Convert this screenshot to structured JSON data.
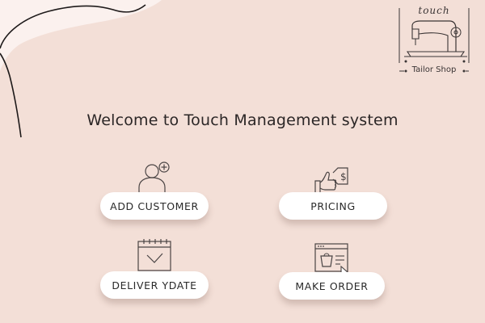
{
  "header": {
    "welcome_text": "Welcome to Touch Management system"
  },
  "logo": {
    "top_text": "touch",
    "bottom_text": "Tailor Shop",
    "icon": "sewing-machine-icon"
  },
  "actions": {
    "add_customer": {
      "label": "ADD CUSTOMER",
      "icon": "add-user-icon"
    },
    "pricing": {
      "label": "PRICING",
      "icon": "price-tag-hand-icon"
    },
    "deliver_date": {
      "label": "DELIVER YDATE",
      "icon": "calendar-check-icon"
    },
    "make_order": {
      "label": "MAKE ORDER",
      "icon": "shopping-bag-window-icon"
    }
  },
  "colors": {
    "background": "#f3dfd7",
    "button": "#ffffff",
    "text": "#2a2a2a",
    "icon_stroke": "#4a4444"
  }
}
